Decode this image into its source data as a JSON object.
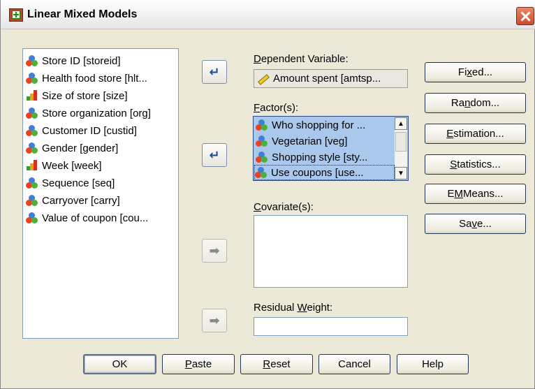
{
  "window": {
    "title": "Linear Mixed Models"
  },
  "source_variables": [
    {
      "label": "Store ID [storeid]",
      "icon": "nominal"
    },
    {
      "label": "Health food store [hlt...",
      "icon": "nominal"
    },
    {
      "label": "Size of store [size]",
      "icon": "ordinal"
    },
    {
      "label": "Store organization [org]",
      "icon": "nominal"
    },
    {
      "label": "Customer ID [custid]",
      "icon": "nominal"
    },
    {
      "label": "Gender [gender]",
      "icon": "nominal"
    },
    {
      "label": "Week [week]",
      "icon": "ordinal"
    },
    {
      "label": "Sequence [seq]",
      "icon": "nominal"
    },
    {
      "label": "Carryover [carry]",
      "icon": "nominal"
    },
    {
      "label": "Value of coupon [cou...",
      "icon": "nominal"
    }
  ],
  "dependent": {
    "label_prefix": "",
    "label_underlined": "D",
    "label_rest": "ependent Variable:",
    "value": "Amount spent [amtsp...",
    "icon": "scale"
  },
  "factors": {
    "label_underlined": "F",
    "label_rest": "actor(s):",
    "items": [
      {
        "label": "Who shopping for ...",
        "icon": "nominal"
      },
      {
        "label": "Vegetarian [veg]",
        "icon": "nominal"
      },
      {
        "label": "Shopping style [sty...",
        "icon": "nominal"
      },
      {
        "label": "Use coupons [use...",
        "icon": "nominal"
      }
    ]
  },
  "covariates": {
    "label_underlined": "C",
    "label_rest": "ovariate(s):"
  },
  "residual_weight": {
    "label_prefix": "Residual ",
    "label_underlined": "W",
    "label_rest": "eight:"
  },
  "side_buttons": {
    "fixed": {
      "pre": "Fi",
      "u": "x",
      "post": "ed..."
    },
    "random": {
      "pre": "Ra",
      "u": "n",
      "post": "dom..."
    },
    "estimation": {
      "pre": "",
      "u": "E",
      "post": "stimation..."
    },
    "statistics": {
      "pre": "",
      "u": "S",
      "post": "tatistics..."
    },
    "em_means": {
      "pre": "E",
      "u": "M",
      "post": " Means..."
    },
    "save": {
      "pre": "Sa",
      "u": "v",
      "post": "e..."
    }
  },
  "bottom_buttons": {
    "ok": "OK",
    "paste": {
      "u": "P",
      "post": "aste"
    },
    "reset": {
      "u": "R",
      "post": "eset"
    },
    "cancel": "Cancel",
    "help": "Help"
  },
  "icons": {
    "app": "linear-mixed-models-icon",
    "close": "close-icon",
    "move_right": "arrow-right-icon",
    "move_left": "arrow-left-icon"
  },
  "colors": {
    "selection": "#a9c8ec",
    "dialog_bg": "#ece9d8",
    "arrow_active": "#1d4f9b",
    "close_button": "#c94c2c"
  }
}
